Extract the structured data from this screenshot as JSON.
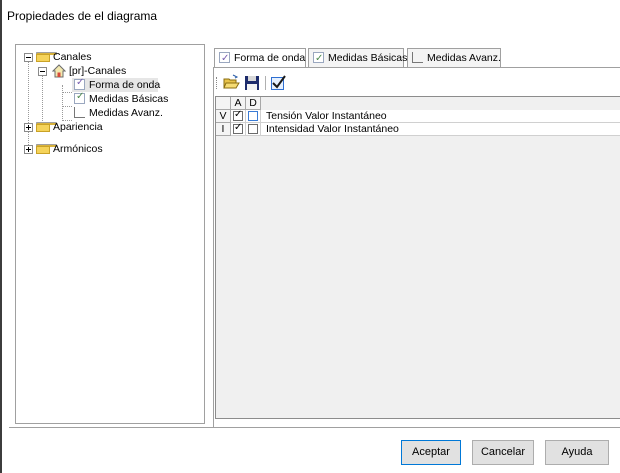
{
  "window": {
    "title": "Propiedades de el diagrama"
  },
  "tree": {
    "canales": "Canales",
    "pr_canales": "[pr]-Canales",
    "forma_de_onda": "Forma de onda",
    "medidas_basicas": "Medidas Básicas",
    "medidas_avanz": "Medidas Avanz.",
    "apariencia": "Apariencia",
    "armonicos": "Armónicos"
  },
  "tabs": [
    {
      "label": "Forma de onda",
      "active": true
    },
    {
      "label": "Medidas Básicas",
      "active": false
    },
    {
      "label": "Medidas Avanz.",
      "active": false
    }
  ],
  "toolbar": {
    "icons": [
      "open-folder-icon",
      "save-disk-icon",
      "check-icon"
    ]
  },
  "grid": {
    "columns": [
      "A",
      "D"
    ],
    "rows": [
      {
        "header": "V",
        "a_checked": true,
        "d_checked": false,
        "label": "Tensión Valor Instantáneo"
      },
      {
        "header": "I",
        "a_checked": true,
        "d_checked": false,
        "label": "Intensidad Valor Instantáneo"
      }
    ]
  },
  "buttons": {
    "accept": "Aceptar",
    "cancel": "Cancelar",
    "help": "Ayuda"
  }
}
